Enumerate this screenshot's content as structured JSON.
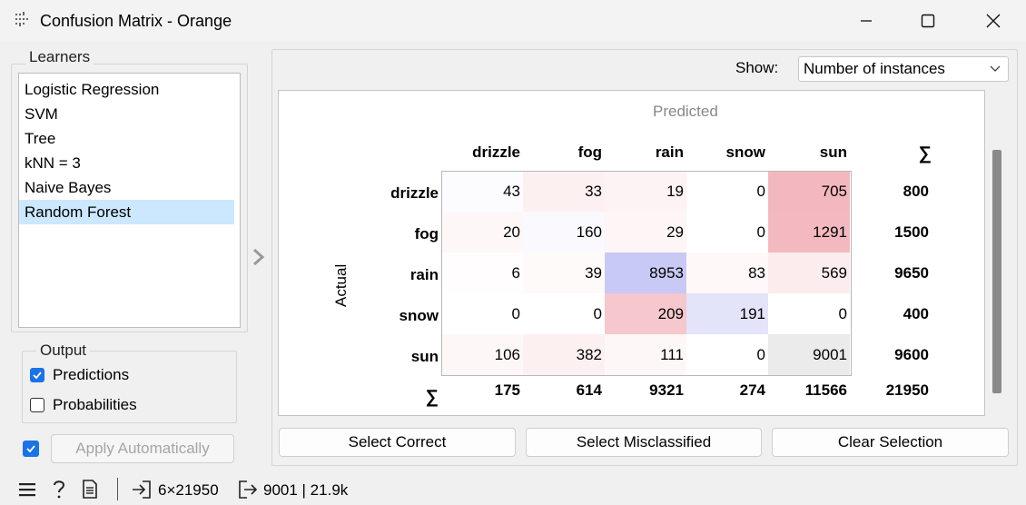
{
  "window": {
    "title": "Confusion Matrix - Orange"
  },
  "learners": {
    "title": "Learners",
    "items": [
      "Logistic Regression",
      "SVM",
      "Tree",
      "kNN = 3",
      "Naive Bayes",
      "Random Forest"
    ],
    "selected": "Random Forest"
  },
  "output": {
    "title": "Output",
    "predictions_label": "Predictions",
    "predictions_checked": true,
    "probabilities_label": "Probabilities",
    "probabilities_checked": false
  },
  "apply": {
    "label": "Apply Automatically",
    "checked": true
  },
  "show": {
    "label": "Show:",
    "value": "Number of instances"
  },
  "matrix": {
    "predicted_label": "Predicted",
    "actual_label": "Actual",
    "sum_symbol": "∑",
    "classes": [
      "drizzle",
      "fog",
      "rain",
      "snow",
      "sun"
    ],
    "rows": [
      [
        "43",
        "33",
        "19",
        "0",
        "705"
      ],
      [
        "20",
        "160",
        "29",
        "0",
        "1291"
      ],
      [
        "6",
        "39",
        "8953",
        "83",
        "569"
      ],
      [
        "0",
        "0",
        "209",
        "191",
        "0"
      ],
      [
        "106",
        "382",
        "111",
        "0",
        "9001"
      ]
    ],
    "row_totals": [
      "800",
      "1500",
      "9650",
      "400",
      "9600"
    ],
    "col_totals": [
      "175",
      "614",
      "9321",
      "274",
      "11566"
    ],
    "grand_total": "21950"
  },
  "buttons": {
    "select_correct": "Select Correct",
    "select_misclassified": "Select Misclassified",
    "clear_selection": "Clear Selection"
  },
  "status": {
    "input_summary": "6×21950",
    "output_summary": "9001 | 21.9k"
  }
}
